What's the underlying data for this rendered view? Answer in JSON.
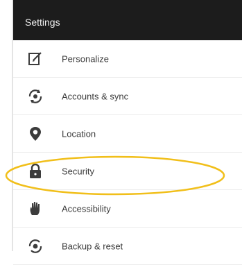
{
  "header": {
    "title": "Settings"
  },
  "menu": {
    "items": [
      {
        "label": "Personalize",
        "icon": "edit-icon"
      },
      {
        "label": "Accounts & sync",
        "icon": "sync-icon"
      },
      {
        "label": "Location",
        "icon": "location-pin-icon"
      },
      {
        "label": "Security",
        "icon": "lock-icon"
      },
      {
        "label": "Accessibility",
        "icon": "hand-icon"
      },
      {
        "label": "Backup & reset",
        "icon": "backup-icon"
      }
    ]
  },
  "annotation": {
    "highlighted_item": "Security",
    "color": "#f1bf1a"
  },
  "colors": {
    "titlebar_bg": "#1c1c1c",
    "icon": "#3c3c3c"
  }
}
